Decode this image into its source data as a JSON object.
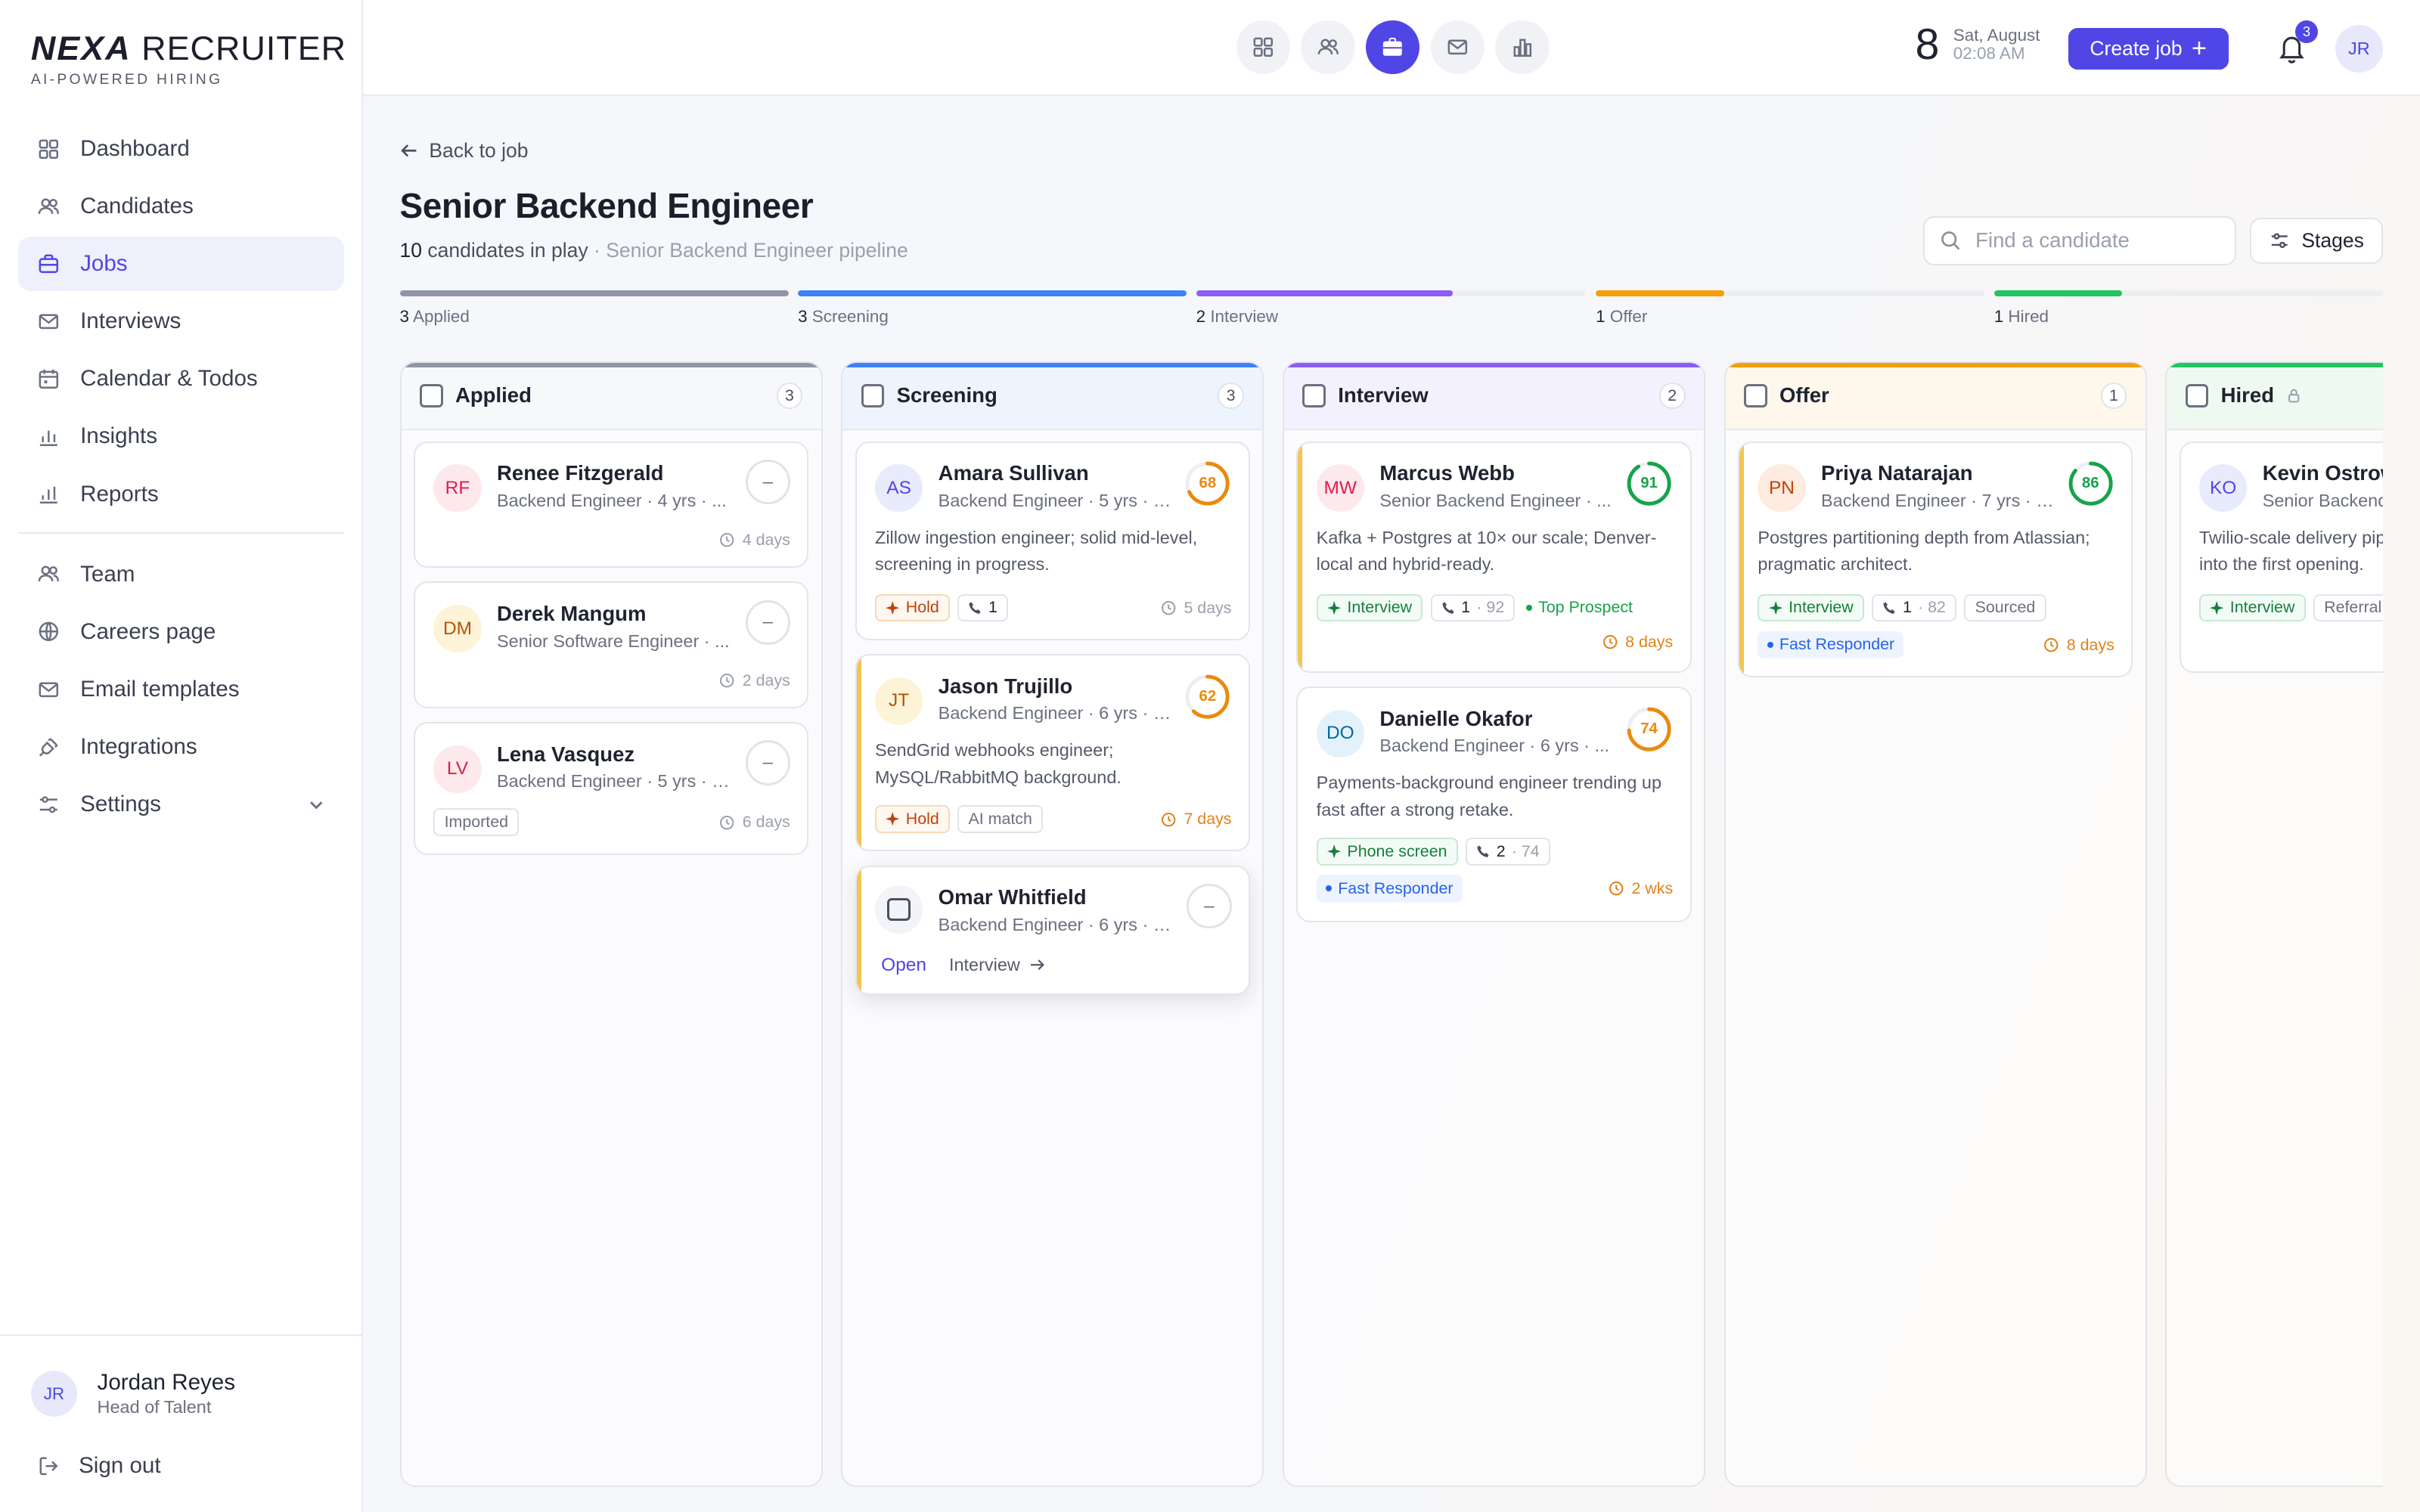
{
  "brand": {
    "name_bold": "NEXA",
    "name_rest": " RECRUITER",
    "tagline": "AI-POWERED HIRING"
  },
  "sidebar": {
    "items": [
      {
        "label": "Dashboard",
        "icon": "grid-icon"
      },
      {
        "label": "Candidates",
        "icon": "users-icon"
      },
      {
        "label": "Jobs",
        "icon": "briefcase-icon",
        "active": true
      },
      {
        "label": "Interviews",
        "icon": "mail-icon"
      },
      {
        "label": "Calendar & Todos",
        "icon": "calendar-icon"
      },
      {
        "label": "Insights",
        "icon": "bar-chart-icon"
      },
      {
        "label": "Reports",
        "icon": "bar-chart-icon"
      }
    ],
    "secondary": [
      {
        "label": "Team",
        "icon": "users-icon"
      },
      {
        "label": "Careers page",
        "icon": "globe-icon"
      },
      {
        "label": "Email templates",
        "icon": "mail-icon"
      },
      {
        "label": "Integrations",
        "icon": "plug-icon"
      },
      {
        "label": "Settings",
        "icon": "sliders-icon"
      }
    ],
    "user": {
      "initials": "JR",
      "name": "Jordan Reyes",
      "role": "Head of Talent"
    },
    "signout": "Sign out"
  },
  "topbar": {
    "date_day": "8",
    "date_label": "Sat, August",
    "time": "02:08 AM",
    "create_job": "Create job",
    "notifications": "3",
    "avatar": "JR"
  },
  "page": {
    "back": "Back to job",
    "title": "Senior Backend Engineer",
    "count": "10",
    "count_text": " candidates in play",
    "subtitle_muted": " · Senior Backend Engineer pipeline",
    "search_placeholder": "Find a candidate",
    "stages_button": "Stages"
  },
  "colors": {
    "accent": "#4f46e5",
    "applied": "#8f97a6",
    "screening": "#3b82f6",
    "interview": "#8b5cf6",
    "offer": "#f59e0b",
    "hired": "#22c55e"
  },
  "progress": [
    {
      "count": "3",
      "label": "Applied",
      "fill": 1.0
    },
    {
      "count": "3",
      "label": "Screening",
      "fill": 1.0
    },
    {
      "count": "2",
      "label": "Interview",
      "fill": 0.66
    },
    {
      "count": "1",
      "label": "Offer",
      "fill": 0.33
    },
    {
      "count": "1",
      "label": "Hired",
      "fill": 0.33
    }
  ],
  "columns": [
    {
      "title": "Applied",
      "count": "3"
    },
    {
      "title": "Screening",
      "count": "3"
    },
    {
      "title": "Interview",
      "count": "2"
    },
    {
      "title": "Offer",
      "count": "1"
    },
    {
      "title": "Hired",
      "count": ""
    }
  ],
  "cards": {
    "rf": {
      "initials": "RF",
      "name": "Renee Fitzgerald",
      "role": "Backend Engineer · 4 yrs · ...",
      "score": "–",
      "time": "4 days"
    },
    "dm": {
      "initials": "DM",
      "name": "Derek Mangum",
      "role": "Senior Software Engineer · ...",
      "score": "–",
      "time": "2 days"
    },
    "lv": {
      "initials": "LV",
      "name": "Lena Vasquez",
      "role": "Backend Engineer · 5 yrs · e...",
      "score": "–",
      "tag": "Imported",
      "time": "6 days"
    },
    "as": {
      "initials": "AS",
      "name": "Amara Sullivan",
      "role": "Backend Engineer · 5 yrs · e...",
      "score": 68,
      "desc": "Zillow ingestion engineer; solid mid-level, screening in progress.",
      "hold": "Hold",
      "calls": "1",
      "time": "5 days"
    },
    "jt": {
      "initials": "JT",
      "name": "Jason Trujillo",
      "role": "Backend Engineer · 6 yrs · e...",
      "score": 62,
      "desc": "SendGrid webhooks engineer; MySQL/RabbitMQ background.",
      "hold": "Hold",
      "tag": "AI match",
      "time": "7 days"
    },
    "ow": {
      "name": "Omar Whitfield",
      "role": "Backend Engineer · 6 yrs · e...",
      "score": "–",
      "open": "Open",
      "move": "Interview"
    },
    "mw": {
      "initials": "MW",
      "name": "Marcus Webb",
      "role": "Senior Backend Engineer · ...",
      "score": 91,
      "desc": "Kafka + Postgres at 10× our scale; Denver-local and hybrid-ready.",
      "stage": "Interview",
      "calls": "1",
      "calls_score": "· 92",
      "flag": "Top Prospect",
      "time": "8 days"
    },
    "do": {
      "initials": "DO",
      "name": "Danielle Okafor",
      "role": "Backend Engineer · 6 yrs · ...",
      "score": 74,
      "desc": "Payments-background engineer trending up fast after a strong retake.",
      "stage": "Phone screen",
      "calls": "2",
      "calls_score": "· 74",
      "flag": "Fast Responder",
      "time": "2 wks"
    },
    "pn": {
      "initials": "PN",
      "name": "Priya Natarajan",
      "role": "Backend Engineer · 7 yrs · e...",
      "score": 86,
      "desc": "Postgres partitioning depth from Atlassian; pragmatic architect.",
      "stage": "Interview",
      "calls": "1",
      "calls_score": "· 82",
      "tag": "Sourced",
      "flag": "Fast Responder",
      "time": "8 days"
    },
    "ko": {
      "initials": "KO",
      "name": "Kevin Ostrow",
      "role": "Senior Backend Engineer",
      "desc": "Twilio-scale delivery pip into the first opening.",
      "stage": "Interview",
      "tag": "Referral"
    }
  }
}
